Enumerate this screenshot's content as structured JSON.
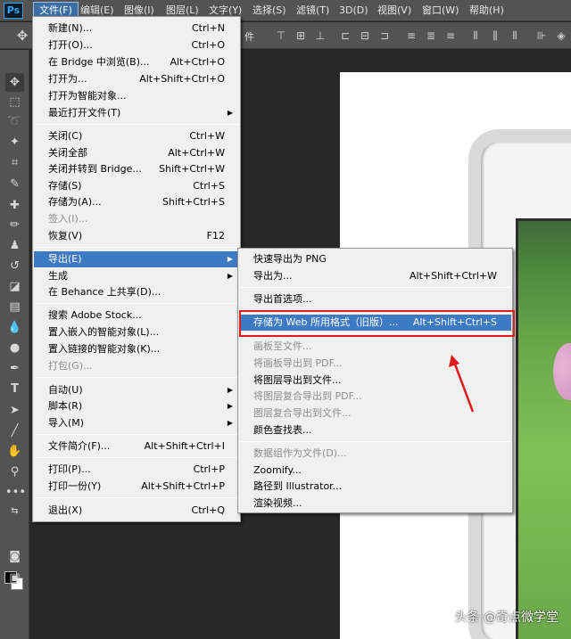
{
  "app": {
    "logo": "Ps"
  },
  "menubar": {
    "items": [
      "文件(F)",
      "编辑(E)",
      "图像(I)",
      "图层(L)",
      "文字(Y)",
      "选择(S)",
      "滤镜(T)",
      "3D(D)",
      "视图(V)",
      "窗口(W)",
      "帮助(H)"
    ],
    "active": "文件(F)"
  },
  "options_bar": {
    "partial_text": "件"
  },
  "file_menu": {
    "items": [
      {
        "label": "新建(N)...",
        "shortcut": "Ctrl+N",
        "enabled": true
      },
      {
        "label": "打开(O)...",
        "shortcut": "Ctrl+O",
        "enabled": true
      },
      {
        "label": "在 Bridge 中浏览(B)...",
        "shortcut": "Alt+Ctrl+O",
        "enabled": true
      },
      {
        "label": "打开为...",
        "shortcut": "Alt+Shift+Ctrl+O",
        "enabled": true
      },
      {
        "label": "打开为智能对象...",
        "shortcut": "",
        "enabled": true
      },
      {
        "label": "最近打开文件(T)",
        "shortcut": "",
        "enabled": true,
        "submenu": true
      },
      {
        "label": "关闭(C)",
        "shortcut": "Ctrl+W",
        "enabled": true
      },
      {
        "label": "关闭全部",
        "shortcut": "Alt+Ctrl+W",
        "enabled": true
      },
      {
        "label": "关闭并转到 Bridge...",
        "shortcut": "Shift+Ctrl+W",
        "enabled": true
      },
      {
        "label": "存储(S)",
        "shortcut": "Ctrl+S",
        "enabled": true
      },
      {
        "label": "存储为(A)...",
        "shortcut": "Shift+Ctrl+S",
        "enabled": true
      },
      {
        "label": "签入(I)...",
        "shortcut": "",
        "enabled": false
      },
      {
        "label": "恢复(V)",
        "shortcut": "F12",
        "enabled": true
      },
      {
        "label": "导出(E)",
        "shortcut": "",
        "enabled": true,
        "submenu": true,
        "active": true
      },
      {
        "label": "生成",
        "shortcut": "",
        "enabled": true,
        "submenu": true
      },
      {
        "label": "在 Behance 上共享(D)...",
        "shortcut": "",
        "enabled": true
      },
      {
        "label": "搜索 Adobe Stock...",
        "shortcut": "",
        "enabled": true
      },
      {
        "label": "置入嵌入的智能对象(L)...",
        "shortcut": "",
        "enabled": true
      },
      {
        "label": "置入链接的智能对象(K)...",
        "shortcut": "",
        "enabled": true
      },
      {
        "label": "打包(G)...",
        "shortcut": "",
        "enabled": false
      },
      {
        "label": "自动(U)",
        "shortcut": "",
        "enabled": true,
        "submenu": true
      },
      {
        "label": "脚本(R)",
        "shortcut": "",
        "enabled": true,
        "submenu": true
      },
      {
        "label": "导入(M)",
        "shortcut": "",
        "enabled": true,
        "submenu": true
      },
      {
        "label": "文件简介(F)...",
        "shortcut": "Alt+Shift+Ctrl+I",
        "enabled": true
      },
      {
        "label": "打印(P)...",
        "shortcut": "Ctrl+P",
        "enabled": true
      },
      {
        "label": "打印一份(Y)",
        "shortcut": "Alt+Shift+Ctrl+P",
        "enabled": true
      },
      {
        "label": "退出(X)",
        "shortcut": "Ctrl+Q",
        "enabled": true
      }
    ]
  },
  "export_submenu": {
    "items": [
      {
        "label": "快速导出为 PNG",
        "shortcut": "",
        "enabled": true
      },
      {
        "label": "导出为...",
        "shortcut": "Alt+Shift+Ctrl+W",
        "enabled": true
      },
      {
        "label": "导出首选项...",
        "shortcut": "",
        "enabled": true
      },
      {
        "label": "存储为 Web 所用格式（旧版）...",
        "shortcut": "Alt+Shift+Ctrl+S",
        "enabled": true,
        "active": true
      },
      {
        "label": "画板至文件...",
        "shortcut": "",
        "enabled": false
      },
      {
        "label": "将画板导出到 PDF...",
        "shortcut": "",
        "enabled": false
      },
      {
        "label": "将图层导出到文件...",
        "shortcut": "",
        "enabled": true
      },
      {
        "label": "将图层复合导出到 PDF...",
        "shortcut": "",
        "enabled": false
      },
      {
        "label": "图层复合导出到文件...",
        "shortcut": "",
        "enabled": false
      },
      {
        "label": "颜色查找表...",
        "shortcut": "",
        "enabled": true
      },
      {
        "label": "数据组作为文件(D)...",
        "shortcut": "",
        "enabled": false
      },
      {
        "label": "Zoomify...",
        "shortcut": "",
        "enabled": true
      },
      {
        "label": "路径到 Illustrator...",
        "shortcut": "",
        "enabled": true
      },
      {
        "label": "渲染视频...",
        "shortcut": "",
        "enabled": true
      }
    ]
  },
  "watermark": "头条 @奇点微学堂",
  "colors": {
    "highlight": "#e11b1b",
    "menu_active": "#3e79c4",
    "ui_dark": "#535353"
  }
}
